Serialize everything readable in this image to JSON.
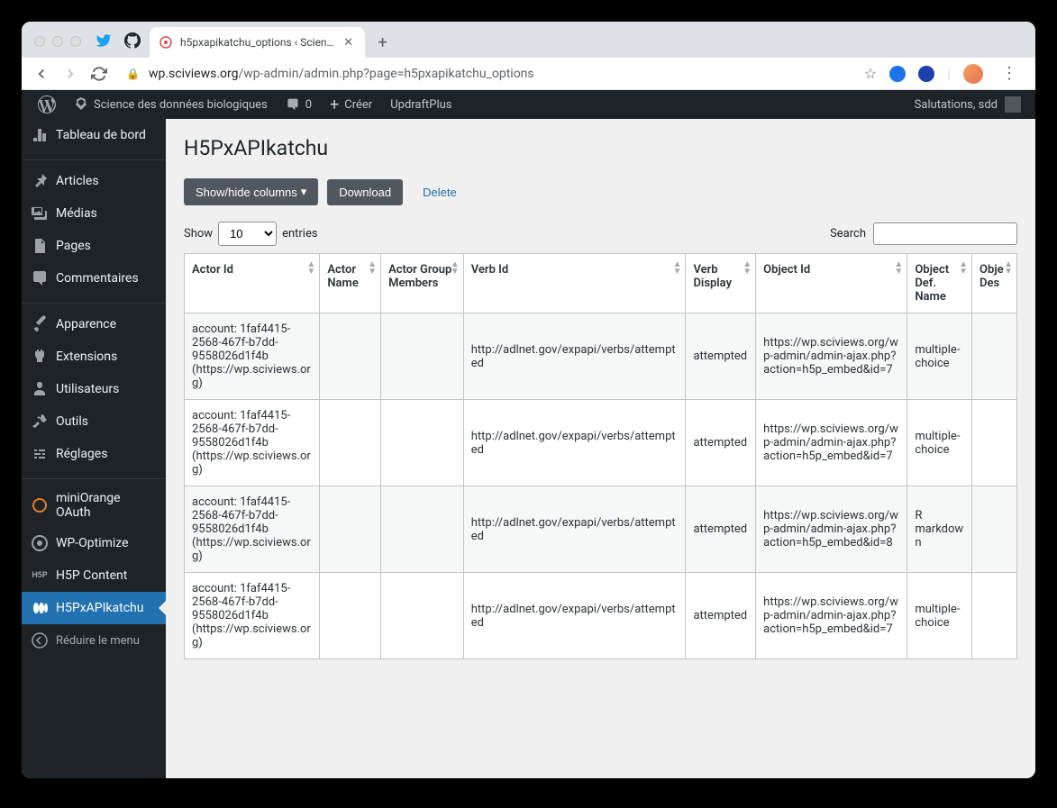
{
  "browser": {
    "tab_title": "h5pxapikatchu_options ‹ Scien…",
    "url_host": "wp.sciviews.org",
    "url_path": "/wp-admin/admin.php?page=h5pxapikatchu_options"
  },
  "toolbar": {
    "site_name": "Science des données biologiques",
    "comments_count": "0",
    "new_label": "Créer",
    "updraft_label": "UpdraftPlus",
    "greeting": "Salutations, sdd"
  },
  "sidebar": {
    "items": [
      {
        "label": "Tableau de bord",
        "icon": "dashboard"
      },
      {
        "label": "Articles",
        "icon": "pin"
      },
      {
        "label": "Médias",
        "icon": "media"
      },
      {
        "label": "Pages",
        "icon": "page"
      },
      {
        "label": "Commentaires",
        "icon": "comment"
      },
      {
        "label": "Apparence",
        "icon": "brush"
      },
      {
        "label": "Extensions",
        "icon": "plugin"
      },
      {
        "label": "Utilisateurs",
        "icon": "users"
      },
      {
        "label": "Outils",
        "icon": "tools"
      },
      {
        "label": "Réglages",
        "icon": "settings"
      },
      {
        "label": "miniOrange OAuth",
        "icon": "oauth"
      },
      {
        "label": "WP-Optimize",
        "icon": "optimize"
      },
      {
        "label": "H5P Content",
        "icon": "h5p"
      },
      {
        "label": "H5PxAPIkatchu",
        "icon": "katchu",
        "current": true
      }
    ],
    "collapse": "Réduire le menu"
  },
  "page": {
    "title": "H5PxAPIkatchu",
    "show_hide": "Show/hide columns",
    "download": "Download",
    "delete": "Delete",
    "show_label": "Show",
    "entries_label": "entries",
    "entries_value": "10",
    "search_label": "Search"
  },
  "table": {
    "headers": [
      "Actor Id",
      "Actor Name",
      "Actor Group Members",
      "Verb Id",
      "Verb Display",
      "Object Id",
      "Object Def. Name",
      "Obje Des"
    ],
    "rows": [
      {
        "actor_id": "account: 1faf4415-2568-467f-b7dd-9558026d1f4b (https://wp.sciviews.org)",
        "actor_name": "",
        "actor_group": "",
        "verb_id": "http://adlnet.gov/expapi/verbs/attempted",
        "verb_display": "attempted",
        "object_id": "https://wp.sciviews.org/wp-admin/admin-ajax.php?action=h5p_embed&id=7",
        "object_name": "multiple-choice"
      },
      {
        "actor_id": "account: 1faf4415-2568-467f-b7dd-9558026d1f4b (https://wp.sciviews.org)",
        "actor_name": "",
        "actor_group": "",
        "verb_id": "http://adlnet.gov/expapi/verbs/attempted",
        "verb_display": "attempted",
        "object_id": "https://wp.sciviews.org/wp-admin/admin-ajax.php?action=h5p_embed&id=7",
        "object_name": "multiple-choice"
      },
      {
        "actor_id": "account: 1faf4415-2568-467f-b7dd-9558026d1f4b (https://wp.sciviews.org)",
        "actor_name": "",
        "actor_group": "",
        "verb_id": "http://adlnet.gov/expapi/verbs/attempted",
        "verb_display": "attempted",
        "object_id": "https://wp.sciviews.org/wp-admin/admin-ajax.php?action=h5p_embed&id=8",
        "object_name": "R markdown"
      },
      {
        "actor_id": "account: 1faf4415-2568-467f-b7dd-9558026d1f4b (https://wp.sciviews.org)",
        "actor_name": "",
        "actor_group": "",
        "verb_id": "http://adlnet.gov/expapi/verbs/attempted",
        "verb_display": "attempted",
        "object_id": "https://wp.sciviews.org/wp-admin/admin-ajax.php?action=h5p_embed&id=7",
        "object_name": "multiple-choice"
      }
    ]
  }
}
